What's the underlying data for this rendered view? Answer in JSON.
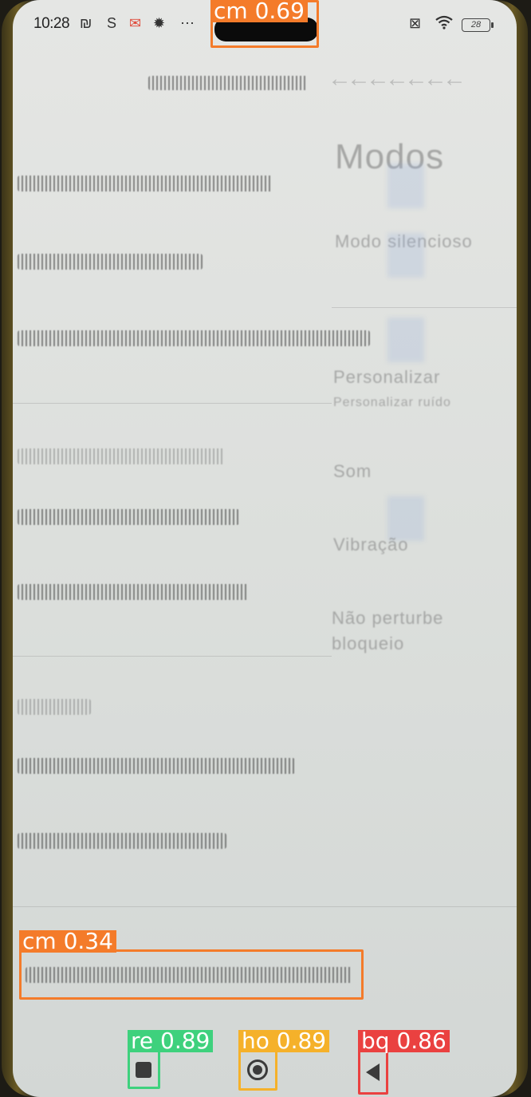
{
  "status_bar": {
    "time": "10:28",
    "icons": [
      "nfc-icon",
      "s-app-icon",
      "mail-app-icon",
      "settings-icon",
      "more-icon",
      "no-sim-icon",
      "wifi-icon"
    ],
    "battery_level": "28"
  },
  "detections": {
    "camera_top": "cm  0.69",
    "camera_bottom": "cm  0.34",
    "recent": "re  0.89",
    "home": "ho  0.89",
    "back": "bq  0.86"
  },
  "colors": {
    "cm": "#f47b2a",
    "re": "#3ed17d",
    "ho": "#f5b12a",
    "bq": "#ea4140"
  },
  "ghost": {
    "title": "Modos",
    "row1": "Modo silencioso",
    "row2": "Personalizar",
    "row2_sub": "Personalizar ruído",
    "row3": "Som",
    "row4": "Vibração",
    "row5": "Não perturbe",
    "row5_sub": "bloqueio"
  }
}
